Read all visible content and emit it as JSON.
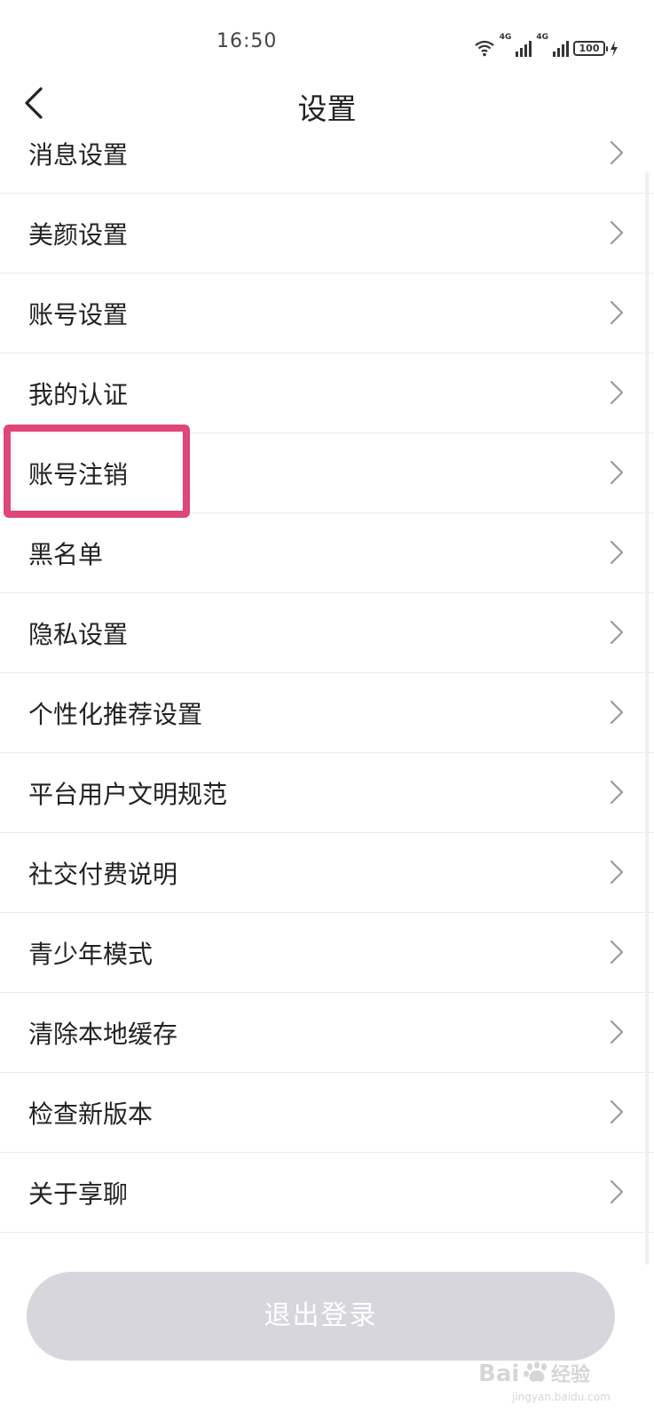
{
  "status_bar": {
    "time": "16:50",
    "network_1": "4G",
    "network_2": "4G",
    "battery": "100"
  },
  "nav": {
    "title": "设置",
    "back_icon": "chevron-left-icon"
  },
  "settings": {
    "items": [
      {
        "label": "消息设置"
      },
      {
        "label": "美颜设置"
      },
      {
        "label": "账号设置"
      },
      {
        "label": "我的认证"
      },
      {
        "label": "账号注销"
      },
      {
        "label": "黑名单"
      },
      {
        "label": "隐私设置"
      },
      {
        "label": "个性化推荐设置"
      },
      {
        "label": "平台用户文明规范"
      },
      {
        "label": "社交付费说明"
      },
      {
        "label": "青少年模式"
      },
      {
        "label": "清除本地缓存"
      },
      {
        "label": "检查新版本"
      },
      {
        "label": "关于享聊"
      }
    ]
  },
  "logout": {
    "label": "退出登录"
  },
  "colors": {
    "highlight": "#e0457b",
    "logout_bg": "#d7d6dc",
    "divider": "#ececec"
  }
}
